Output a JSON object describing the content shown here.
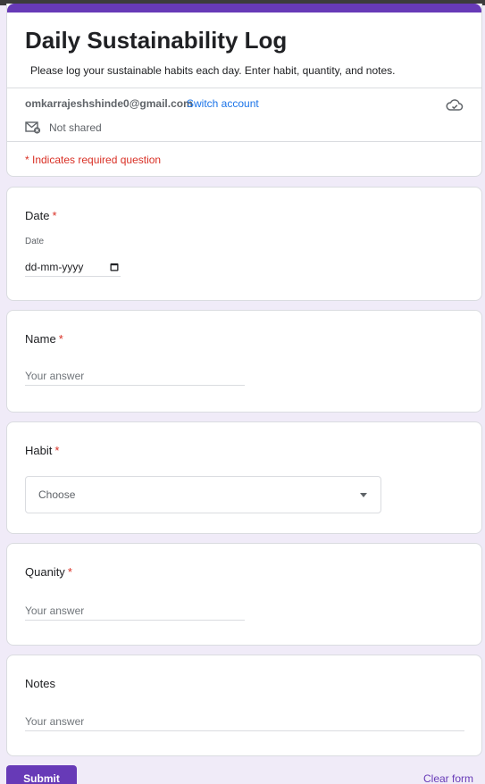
{
  "header": {
    "title": "Daily Sustainability Log",
    "description": "Please log your sustainable habits each day. Enter habit, quantity, and notes.",
    "account_email": "omkarrajeshshinde0@gmail.com",
    "switch_account": "Switch account",
    "not_shared": "Not shared",
    "required_note": "* Indicates required question"
  },
  "questions": {
    "date": {
      "title": "Date",
      "required_mark": "*",
      "sub_label": "Date",
      "placeholder": "dd-mm-yyyy"
    },
    "name": {
      "title": "Name",
      "required_mark": "*",
      "placeholder": "Your answer"
    },
    "habit": {
      "title": "Habit",
      "required_mark": "*",
      "selected": "Choose"
    },
    "quantity": {
      "title": "Quanity",
      "required_mark": "*",
      "placeholder": "Your answer"
    },
    "notes": {
      "title": "Notes",
      "placeholder": "Your answer"
    }
  },
  "footer": {
    "submit": "Submit",
    "clear": "Clear form"
  },
  "colors": {
    "accent": "#673ab7",
    "required": "#d93025",
    "link": "#1a73e8",
    "background": "#f0ebf8"
  },
  "icons": {
    "cloud": "cloud-check-icon",
    "mail": "mail-not-shared-icon",
    "calendar": "calendar-icon",
    "dropdown": "caret-down-icon"
  }
}
